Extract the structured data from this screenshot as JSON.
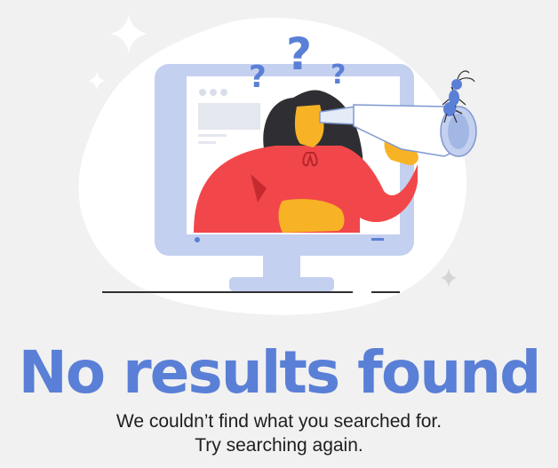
{
  "empty_state": {
    "title": "No results found",
    "message_line1": "We couldn’t find what you searched for.",
    "message_line2": "Try searching again."
  },
  "colors": {
    "background": "#f1f1f1",
    "blob": "#ffffff",
    "monitor_frame": "#c3d0ef",
    "accent_blue": "#5a7fd6",
    "shirt": "#f2474a",
    "skin": "#f7b325",
    "hair": "#2f2f33"
  },
  "icons": [
    "sparkle-icon",
    "question-mark-icon",
    "monitor-icon",
    "telescope-icon",
    "ant-icon",
    "person-illustration"
  ]
}
